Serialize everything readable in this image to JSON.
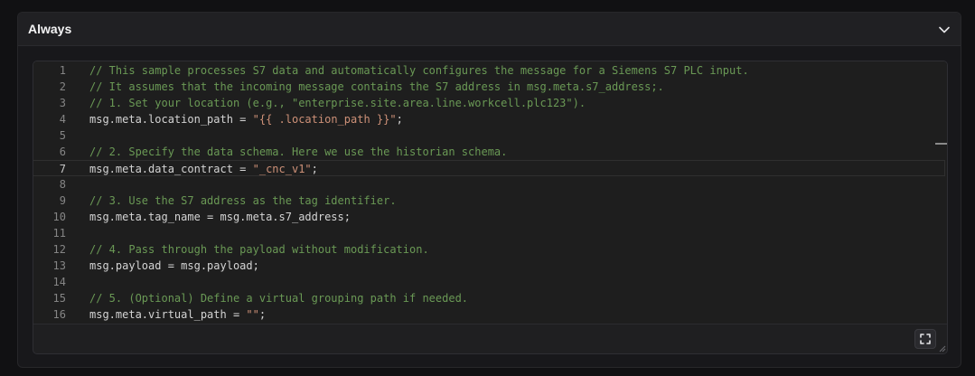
{
  "section": {
    "title": "Always",
    "toggle_icon": "chevron-down-icon"
  },
  "editor": {
    "active_line": 7,
    "lines": [
      {
        "num": "1",
        "tokens": [
          {
            "t": "comment",
            "v": "// This sample processes S7 data and automatically configures the message for a Siemens S7 PLC input."
          }
        ]
      },
      {
        "num": "2",
        "tokens": [
          {
            "t": "comment",
            "v": "// It assumes that the incoming message contains the S7 address in msg.meta.s7_address;."
          }
        ]
      },
      {
        "num": "3",
        "tokens": [
          {
            "t": "comment",
            "v": "// 1. Set your location (e.g., \"enterprise.site.area.line.workcell.plc123\")."
          }
        ]
      },
      {
        "num": "4",
        "tokens": [
          {
            "t": "plain",
            "v": "msg.meta.location_path = "
          },
          {
            "t": "string",
            "v": "\"{{ .location_path }}\""
          },
          {
            "t": "plain",
            "v": ";"
          }
        ]
      },
      {
        "num": "5",
        "tokens": []
      },
      {
        "num": "6",
        "tokens": [
          {
            "t": "comment",
            "v": "// 2. Specify the data schema. Here we use the historian schema."
          }
        ]
      },
      {
        "num": "7",
        "tokens": [
          {
            "t": "plain",
            "v": "msg.meta.data_contract = "
          },
          {
            "t": "string",
            "v": "\"_cnc_v1\""
          },
          {
            "t": "plain",
            "v": ";"
          }
        ]
      },
      {
        "num": "8",
        "tokens": []
      },
      {
        "num": "9",
        "tokens": [
          {
            "t": "comment",
            "v": "// 3. Use the S7 address as the tag identifier."
          }
        ]
      },
      {
        "num": "10",
        "tokens": [
          {
            "t": "plain",
            "v": "msg.meta.tag_name = msg.meta.s7_address;"
          }
        ]
      },
      {
        "num": "11",
        "tokens": []
      },
      {
        "num": "12",
        "tokens": [
          {
            "t": "comment",
            "v": "// 4. Pass through the payload without modification."
          }
        ]
      },
      {
        "num": "13",
        "tokens": [
          {
            "t": "plain",
            "v": "msg.payload = msg.payload;"
          }
        ]
      },
      {
        "num": "14",
        "tokens": []
      },
      {
        "num": "15",
        "tokens": [
          {
            "t": "comment",
            "v": "// 5. (Optional) Define a virtual grouping path if needed."
          }
        ]
      },
      {
        "num": "16",
        "tokens": [
          {
            "t": "plain",
            "v": "msg.meta.virtual_path = "
          },
          {
            "t": "string",
            "v": "\"\""
          },
          {
            "t": "plain",
            "v": ";"
          }
        ]
      }
    ],
    "expand_icon": "fullscreen-icon"
  },
  "colors": {
    "comment": "#6a9955",
    "string": "#ce9178",
    "code": "#d4d4d4",
    "line_number": "#858585"
  }
}
